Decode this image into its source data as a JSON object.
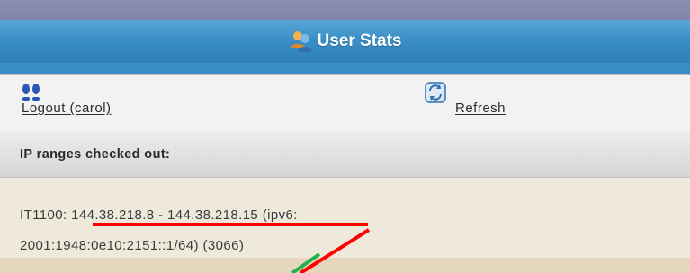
{
  "header": {
    "title": "User Stats",
    "icon": "users-icon"
  },
  "actions": {
    "logout_label": "Logout (carol)",
    "logout_icon": "footprints-icon",
    "refresh_label": "Refresh",
    "refresh_icon": "refresh-icon"
  },
  "section": {
    "label": "IP ranges checked out:"
  },
  "range": {
    "name": "IT1100:",
    "ipv4_range": "144.38.218.8 - 144.38.218.15",
    "ipv6_prefix": "(ipv6:",
    "ipv6_address": "2001:1948:0e10:2151::1/64)",
    "count": "(3066)"
  },
  "annotations": {
    "red_color": "#ff0000",
    "green_color": "#22b14c"
  }
}
